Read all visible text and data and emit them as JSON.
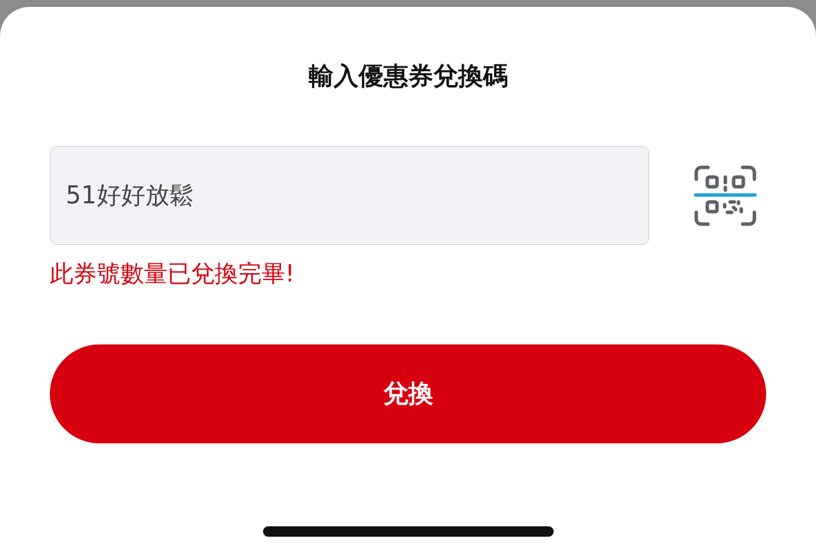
{
  "sheet": {
    "title": "輸入優惠券兌換碼"
  },
  "code_field": {
    "value": "51好好放鬆"
  },
  "error_message": "此券號數量已兌換完畢!",
  "redeem_button": "兌換"
}
